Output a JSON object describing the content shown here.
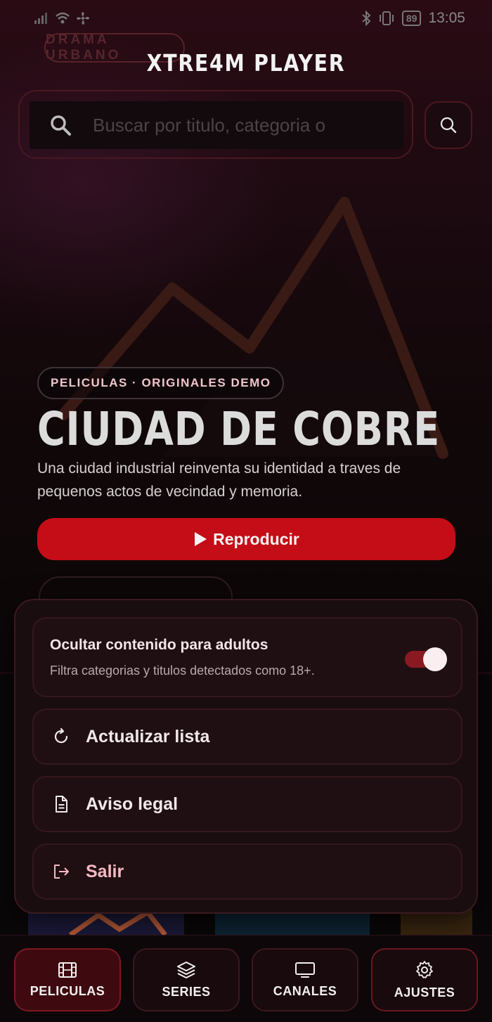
{
  "status_bar": {
    "battery": "89",
    "time": "13:05"
  },
  "hero": {
    "genre_badge": "DRAMA URBANO",
    "category": "PELICULAS · ORIGINALES DEMO",
    "title": "CIUDAD DE COBRE",
    "description": "Una ciudad industrial reinventa su identidad a traves de pequenos actos de vecindad y memoria.",
    "play_label": "Reproducir"
  },
  "header": {
    "app_title": "XTRE4M PLAYER"
  },
  "search": {
    "placeholder": "Buscar por titulo, categoria o"
  },
  "settings_sheet": {
    "adult_filter": {
      "title": "Ocultar contenido para adultos",
      "subtitle": "Filtra categorias y titulos detectados como 18+.",
      "enabled": true
    },
    "items": [
      {
        "label": "Actualizar lista",
        "icon": "refresh-icon"
      },
      {
        "label": "Aviso legal",
        "icon": "document-icon"
      },
      {
        "label": "Salir",
        "icon": "logout-icon"
      }
    ]
  },
  "bottom_nav": {
    "items": [
      {
        "label": "PELICULAS",
        "icon": "film-icon",
        "active": true
      },
      {
        "label": "SERIES",
        "icon": "layers-icon",
        "active": false
      },
      {
        "label": "CANALES",
        "icon": "tv-icon",
        "active": false
      },
      {
        "label": "AJUSTES",
        "icon": "gear-icon",
        "active": false
      }
    ]
  },
  "colors": {
    "accent": "#c50d17",
    "background": "#0a0708",
    "sheet": "#1a0d10"
  }
}
